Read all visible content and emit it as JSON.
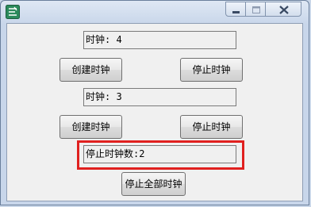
{
  "clock1": {
    "display": "时钟: 4",
    "create_label": "创建时钟",
    "stop_label": "停止时钟"
  },
  "clock2": {
    "display": "时钟: 3",
    "create_label": "创建时钟",
    "stop_label": "停止时钟"
  },
  "stopped_count": "停止时钟数:2",
  "stop_all_label": "停止全部时钟",
  "colors": {
    "highlight": "#e0201f",
    "client_bg": "#f0f0f0"
  },
  "icons": {
    "app": "app-icon",
    "minimize": "minimize-icon",
    "maximize": "maximize-icon",
    "close": "close-icon"
  }
}
